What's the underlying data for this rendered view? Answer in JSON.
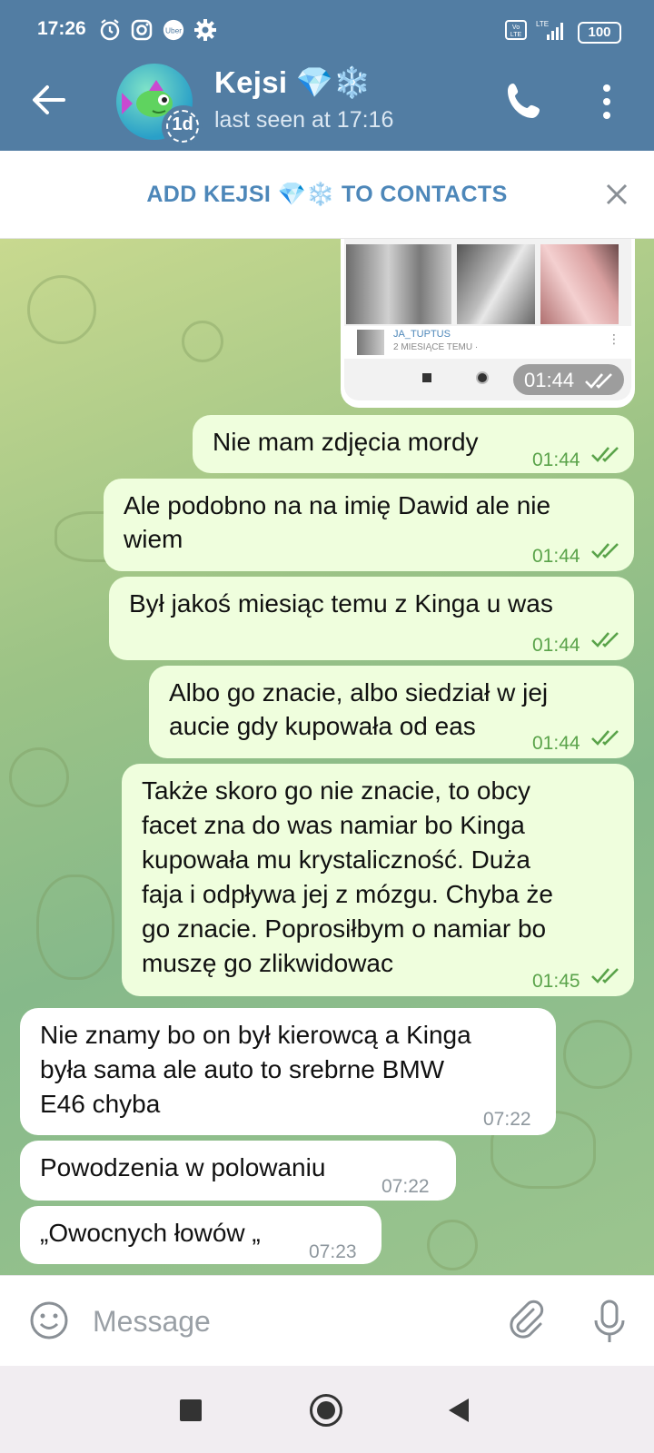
{
  "status_bar": {
    "time": "17:26",
    "battery": "100",
    "network": "LTE"
  },
  "header": {
    "contact_name": "Kejsi 💎❄️",
    "last_seen": "last seen at 17:16",
    "story_badge": "1d"
  },
  "add_contact": {
    "label": "ADD KEJSI 💎❄️ TO CONTACTS"
  },
  "media_preview": {
    "profile_name": "JA_TUPTUS",
    "profile_sub": "2 MIESIĄCE TEMU ·",
    "time": "01:44"
  },
  "messages": [
    {
      "direction": "out",
      "lines": [
        "Nie mam zdjęcia mordy"
      ],
      "time": "01:44"
    },
    {
      "direction": "out",
      "lines": [
        "Ale podobno na na imię Dawid ale nie",
        "wiem"
      ],
      "time": "01:44"
    },
    {
      "direction": "out",
      "lines": [
        "Był jakoś miesiąc temu z Kinga u was"
      ],
      "time": "01:44"
    },
    {
      "direction": "out",
      "lines": [
        "Albo go znacie, albo siedział w jej",
        "aucie gdy kupowała od eas"
      ],
      "time": "01:44"
    },
    {
      "direction": "out",
      "lines": [
        "Także skoro go nie znacie, to obcy",
        "facet zna do was namiar bo Kinga",
        "kupowała mu krystaliczność. Duża",
        "faja i odpływa jej z mózgu. Chyba że",
        "go znacie. Poprosiłbym o namiar bo",
        "muszę go zlikwidowac"
      ],
      "time": "01:45"
    },
    {
      "direction": "in",
      "lines": [
        "Nie znamy bo on był kierowcą a Kinga",
        "była sama ale auto to srebrne BMW",
        "E46 chyba"
      ],
      "time": "07:22"
    },
    {
      "direction": "in",
      "lines": [
        "Powodzenia w polowaniu"
      ],
      "time": "07:22"
    },
    {
      "direction": "in",
      "lines": [
        "„Owocnych łowów „"
      ],
      "time": "07:23"
    }
  ],
  "input": {
    "placeholder": "Message"
  },
  "colors": {
    "header": "#527da3",
    "outgoing_bubble": "#effedd",
    "incoming_bubble": "#ffffff",
    "accent": "#4d87b9",
    "check": "#5aa34a"
  },
  "icons": [
    "back-arrow-icon",
    "phone-icon",
    "more-vertical-icon",
    "close-icon",
    "emoji-icon",
    "attach-icon",
    "mic-icon",
    "alarm-icon",
    "instagram-icon",
    "uber-icon",
    "gear-icon",
    "volte-icon",
    "signal-icon",
    "battery-icon"
  ]
}
